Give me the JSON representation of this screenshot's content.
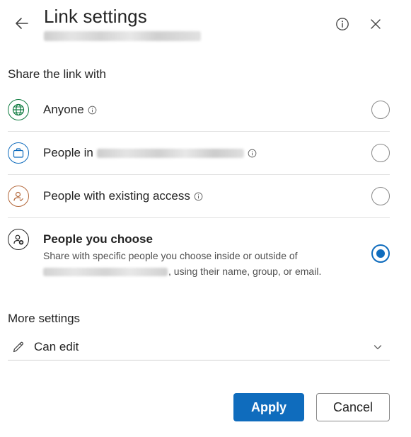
{
  "header": {
    "title": "Link settings",
    "back_icon": "arrow-left-icon",
    "info_icon": "info-icon",
    "close_icon": "close-icon"
  },
  "share_section": {
    "heading": "Share the link with",
    "options": [
      {
        "label": "Anyone",
        "icon": "globe-icon",
        "selected": false
      },
      {
        "label": "People in",
        "icon": "briefcase-icon",
        "selected": false
      },
      {
        "label": "People with existing access",
        "icon": "person-check-icon",
        "selected": false
      },
      {
        "label": "People you choose",
        "description": ", using their name, group, or email.",
        "description_prefix": "Share with specific people you choose inside or outside of",
        "icon": "person-add-icon",
        "selected": true
      }
    ]
  },
  "more_settings": {
    "heading": "More settings",
    "permission": "Can edit",
    "permission_icon": "pencil-icon"
  },
  "footer": {
    "apply_label": "Apply",
    "cancel_label": "Cancel"
  },
  "colors": {
    "accent": "#0f6cbd",
    "globe_icon": "#107c41",
    "briefcase_icon": "#0f6cbd",
    "person_icon": "#b3683b",
    "person_add_icon": "#242424"
  }
}
